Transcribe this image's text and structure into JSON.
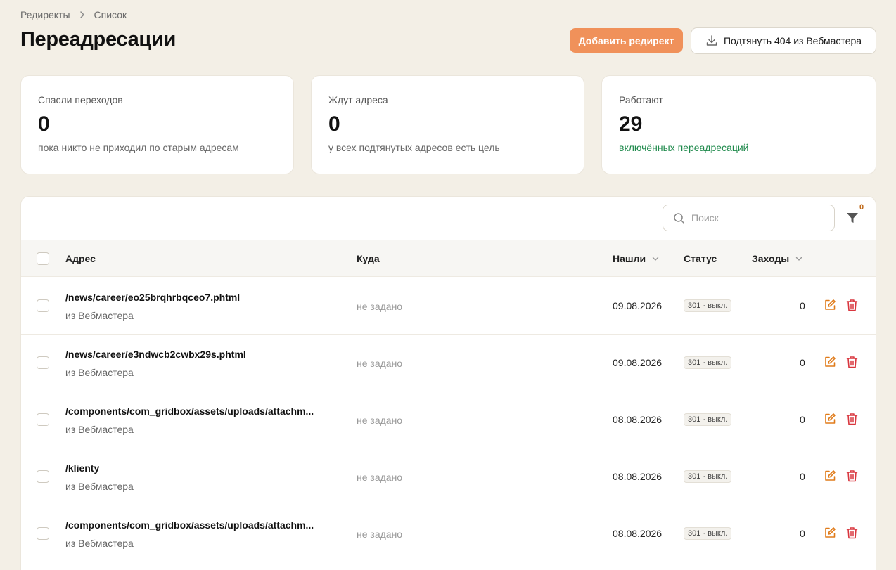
{
  "breadcrumb": {
    "items": [
      "Редиректы",
      "Список"
    ]
  },
  "page": {
    "title": "Переадресации"
  },
  "actions": {
    "add_label": "Добавить редирект",
    "pull_label": "Подтянуть 404 из Вебмастера"
  },
  "stats": [
    {
      "label": "Спасли переходов",
      "value": "0",
      "sub": "пока никто не приходил по старым адресам"
    },
    {
      "label": "Ждут адреса",
      "value": "0",
      "sub": "у всех подтянутых адресов есть цель"
    },
    {
      "label": "Работают",
      "value": "29",
      "sub": "включённых переадресаций"
    }
  ],
  "search": {
    "placeholder": "Поиск"
  },
  "filter": {
    "count": "0"
  },
  "table": {
    "headers": {
      "address": "Адрес",
      "destination": "Куда",
      "found": "Нашли",
      "status": "Статус",
      "hits": "Заходы"
    },
    "rows": [
      {
        "address": "/news/career/eo25brqhrbqceo7.phtml",
        "source": "из Вебмастера",
        "destination": "не задано",
        "date": "09.08.2026",
        "status": "301 · выкл.",
        "hits": "0"
      },
      {
        "address": "/news/career/e3ndwcb2cwbx29s.phtml",
        "source": "из Вебмастера",
        "destination": "не задано",
        "date": "09.08.2026",
        "status": "301 · выкл.",
        "hits": "0"
      },
      {
        "address": "/components/com_gridbox/assets/uploads/attachm...",
        "source": "из Вебмастера",
        "destination": "не задано",
        "date": "08.08.2026",
        "status": "301 · выкл.",
        "hits": "0"
      },
      {
        "address": "/klienty",
        "source": "из Вебмастера",
        "destination": "не задано",
        "date": "08.08.2026",
        "status": "301 · выкл.",
        "hits": "0"
      },
      {
        "address": "/components/com_gridbox/assets/uploads/attachm...",
        "source": "из Вебмастера",
        "destination": "не задано",
        "date": "08.08.2026",
        "status": "301 · выкл.",
        "hits": "0"
      }
    ]
  },
  "colors": {
    "accent": "#f0915a",
    "success": "#1f8a4c",
    "edit_icon": "#e07b1a",
    "delete_icon": "#d9363e",
    "background": "#f3efe6"
  },
  "icons": {
    "breadcrumb_sep": "chevron-right-icon",
    "pull": "download-icon",
    "search": "search-icon",
    "filter": "filter-icon",
    "sort": "chevron-down-icon",
    "edit": "edit-icon",
    "delete": "trash-icon"
  }
}
